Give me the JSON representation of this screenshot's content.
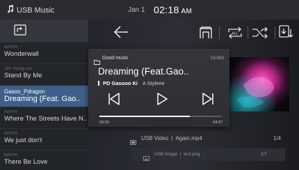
{
  "status": {
    "app_title": "USB Music",
    "date": "Jan 1",
    "time": "02:18",
    "ampm": "AM"
  },
  "playlist": [
    {
      "artist": "KimYH",
      "title": "Wonderwall",
      "active": false
    },
    {
      "artist": "Joo Young LEE",
      "title": "Stand By Me",
      "active": false
    },
    {
      "artist": "Gasoo_Pdragon",
      "title": "Dreaming (Feat. Gao..",
      "active": true
    },
    {
      "artist": "KimYH",
      "title": "Where The Streets Have N..",
      "active": false
    },
    {
      "artist": "KimYH",
      "title": "We just don't",
      "active": false
    },
    {
      "artist": "KimYH",
      "title": "There Be Love",
      "active": false
    }
  ],
  "now_playing": {
    "folder": "Good music",
    "track_count": "15/369",
    "title": "Dreaming (Feat.Gao..",
    "artist": "PD Gasooo Ki",
    "album": "A Styleee",
    "elapsed": "03:25",
    "duration": "04:37",
    "progress": 0.74
  },
  "sources": [
    {
      "label": "USB Video  |  Again.mp4",
      "count": "1/4",
      "icon": "video-icon"
    },
    {
      "label": "USB Image  |  test.png",
      "count": "1/7",
      "icon": "image-icon"
    }
  ],
  "colors": {
    "accent": "#3e5f8a",
    "progress_fill": "#ffffff",
    "progress_track": "#5a5d63"
  }
}
